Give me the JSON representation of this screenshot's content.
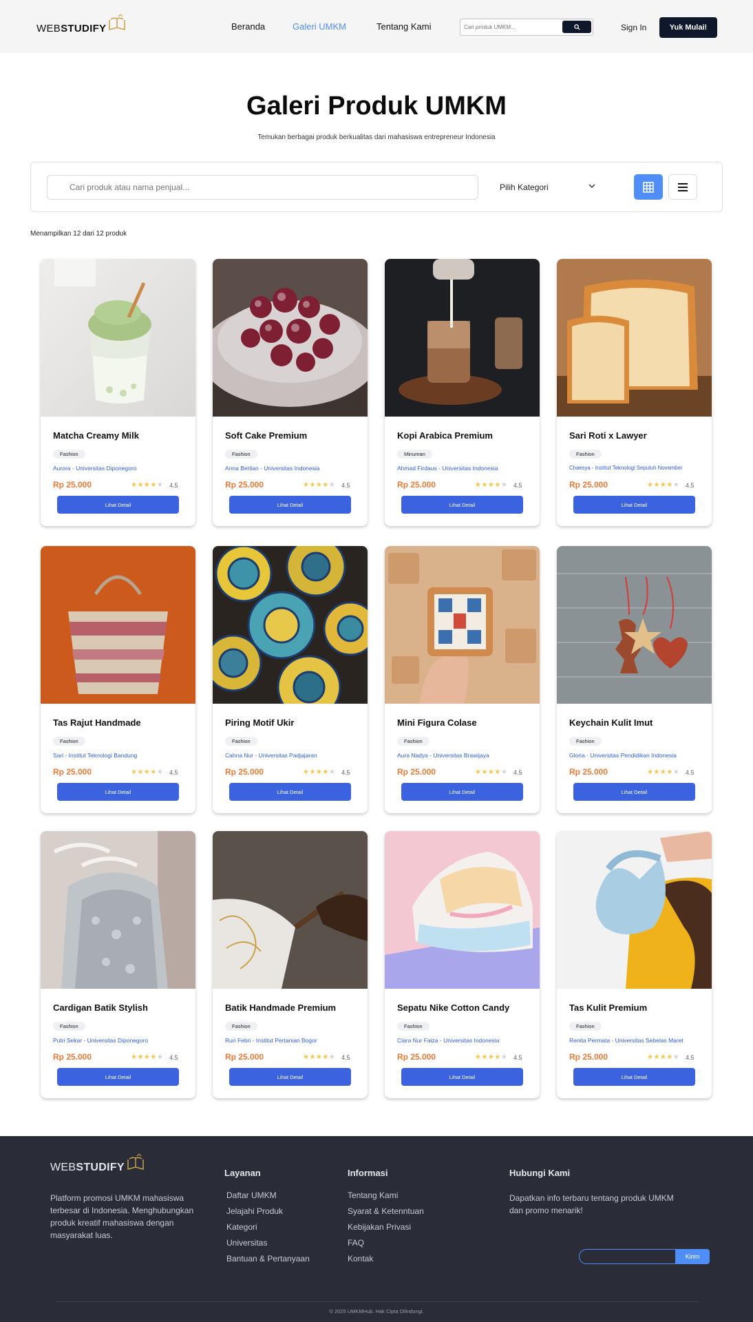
{
  "header": {
    "logo_light": "WEB",
    "logo_bold": "STUDIFY",
    "nav": {
      "home": "Beranda",
      "gallery": "Galeri UMKM",
      "about": "Tentang Kami"
    },
    "search_placeholder": "Cari produk UMKM...",
    "signin": "Sign In",
    "cta": "Yuk Mulai!"
  },
  "hero": {
    "title": "Galeri Produk UMKM",
    "subtitle": "Temukan berbagai produk berkualitas dari mahasiswa entrepreneur Indonesia"
  },
  "filter": {
    "search_placeholder": "Cari produk atau nama penjual...",
    "category_label": "Pilih Kategori"
  },
  "results_info": "Menampilkan 12 dari 12 produk",
  "colors": {
    "accent": "#4f8ef7",
    "button": "#3b63e0",
    "price": "#ea7a35",
    "seller": "#2f5de0",
    "dark": "#0f172a",
    "footer_bg": "#2a2d37"
  },
  "products": [
    {
      "name": "Matcha Creamy Milk",
      "category": "Fashion",
      "seller": "Aurora - Universitas Diponegoro",
      "price": "Rp 25.000",
      "rating": "4.5",
      "button": "Lihat Detail"
    },
    {
      "name": "Soft Cake Premium",
      "category": "Fashion",
      "seller": "Anna Berlian - Universitas Indonesia",
      "price": "Rp 25.000",
      "rating": "4.5",
      "button": "Lihat Detail"
    },
    {
      "name": "Kopi Arabica Premium",
      "category": "Minuman",
      "seller": "Ahmad Firdaus - Universitas Indonesia",
      "price": "Rp 25.000",
      "rating": "4.5",
      "button": "Lihat Detail"
    },
    {
      "name": "Sari Roti x Lawyer",
      "category": "Fashion",
      "seller": "Chaesya - Institut Teknologi Sepuluh November",
      "price": "Rp 25.000",
      "rating": "4.5",
      "button": "Lihat Detail"
    },
    {
      "name": "Tas Rajut Handmade",
      "category": "Fashion",
      "seller": "Sari - Institut Teknologi Bandung",
      "price": "Rp 25.000",
      "rating": "4.5",
      "button": "Lihat Detail"
    },
    {
      "name": "Piring Motif Ukir",
      "category": "Fashion",
      "seller": "Cahna Nur - Universitas Padjajaran",
      "price": "Rp 25.000",
      "rating": "4.5",
      "button": "Lihat Detail"
    },
    {
      "name": "Mini Figura Colase",
      "category": "Fashion",
      "seller": "Aura Nadya - Universitas Brawijaya",
      "price": "Rp 25.000",
      "rating": "4.5",
      "button": "Lihat Detail"
    },
    {
      "name": "Keychain Kulit Imut",
      "category": "Fashion",
      "seller": "Gloria - Universitas Pendidikan Indonesia",
      "price": "Rp 25.000",
      "rating": "4.5",
      "button": "Lihat Detail"
    },
    {
      "name": "Cardigan Batik Stylish",
      "category": "Fashion",
      "seller": "Putri Sekar - Universitas Diponegoro",
      "price": "Rp 25.000",
      "rating": "4.5",
      "button": "Lihat Detail"
    },
    {
      "name": "Batik Handmade Premium",
      "category": "Fashion",
      "seller": "Ruri Febri - Institut Pertanian Bogor",
      "price": "Rp 25.000",
      "rating": "4.5",
      "button": "Lihat Detail"
    },
    {
      "name": "Sepatu Nike Cotton Candy",
      "category": "Fashion",
      "seller": "Clara Nur Faiza - Universitas Indonesia",
      "price": "Rp 25.000",
      "rating": "4.5",
      "button": "Lihat Detail"
    },
    {
      "name": "Tas Kulit Premium",
      "category": "Fashion",
      "seller": "Renita Permata - Universitas Sebelas Maret",
      "price": "Rp 25.000",
      "rating": "4.5",
      "button": "Lihat Detail"
    }
  ],
  "footer": {
    "about": "Platform promosi UMKM mahasiswa terbesar di Indonesia. Menghubungkan produk kreatif mahasiswa dengan masyarakat luas.",
    "services_title": "Layanan",
    "services": [
      "Daftar UMKM",
      "Jelajahi Produk",
      "Kategori",
      "Universitas",
      "Bantuan & Pertanyaan"
    ],
    "info_title": "Informasi",
    "info": [
      "Tentang Kami",
      "Syarat & Ketenntuan",
      "Kebijakan Privasi",
      "FAQ",
      "Kontak"
    ],
    "contact_title": "Hubungi Kami",
    "contact_text": "Dapatkan info terbaru tentang produk UMKM dan promo menarik!",
    "subscribe_button": "Kirim",
    "copyright": "© 2025 UMKMHub. Hak Cipta Dilindungi."
  }
}
